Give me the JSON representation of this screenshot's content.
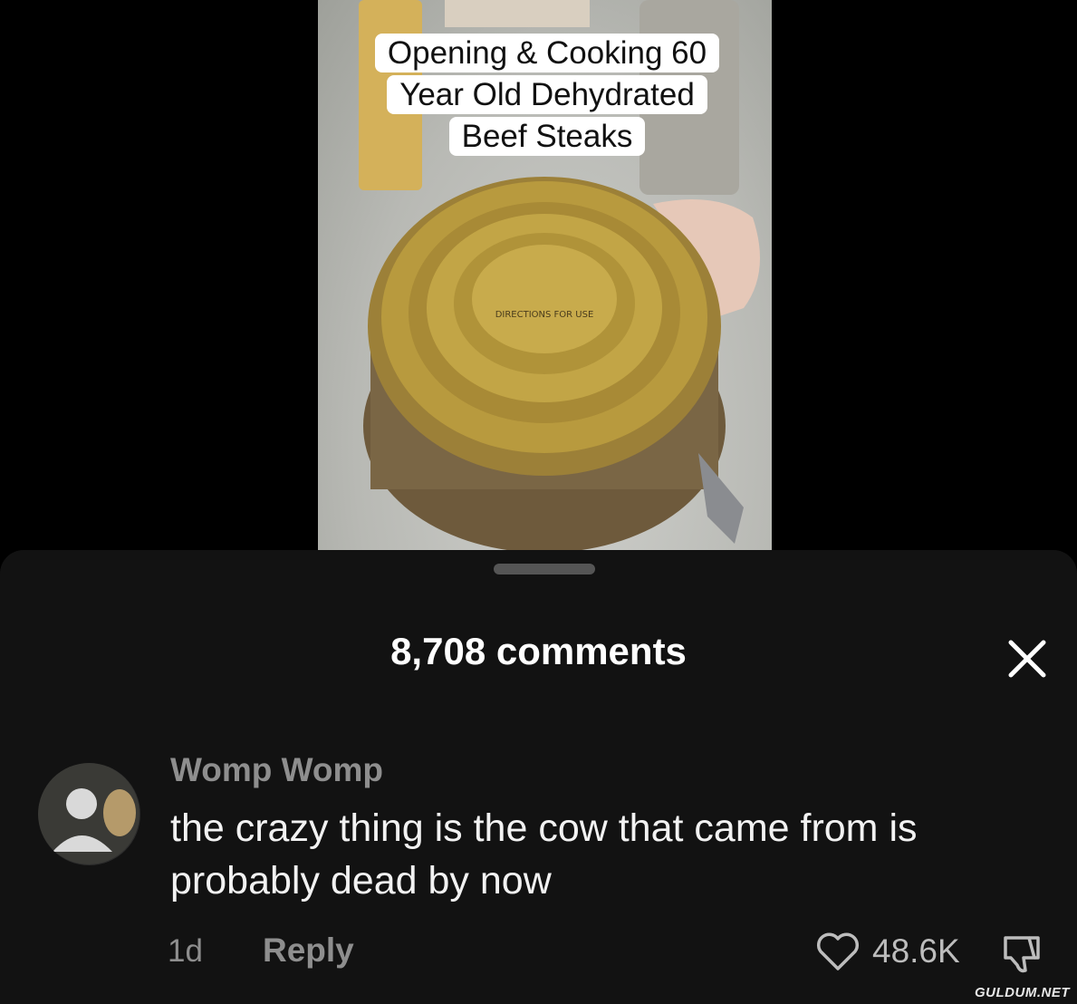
{
  "video": {
    "caption_lines": [
      "Opening & Cooking 60",
      "Year Old Dehydrated",
      "Beef Steaks"
    ]
  },
  "comments_panel": {
    "count_label": "8,708 comments"
  },
  "comment": {
    "author": "Womp Womp",
    "text": "the crazy thing is the cow that came from is probably dead by now",
    "age": "1d",
    "reply_label": "Reply",
    "likes": "48.6K"
  },
  "watermark": "GULDUM.NET",
  "icons": {
    "close": "close-icon",
    "like": "heart-icon",
    "dislike": "thumbs-down-icon"
  }
}
